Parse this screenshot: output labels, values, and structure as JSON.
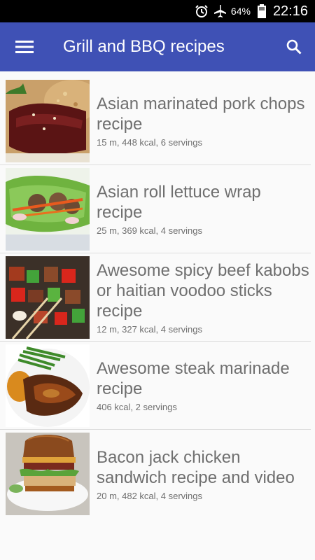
{
  "status": {
    "battery": "64%",
    "time": "22:16",
    "icons": [
      "alarm-icon",
      "airplane-mode-icon",
      "battery-icon"
    ]
  },
  "appbar": {
    "title": "Grill and BBQ recipes",
    "menu_icon": "hamburger-menu-icon",
    "search_icon": "search-icon"
  },
  "colors": {
    "appbar": "#3f51b5",
    "text": "#6f6f6f",
    "background": "#fafafa",
    "divider": "#dddddd"
  },
  "recipes": [
    {
      "title": "Asian marinated pork chops recipe",
      "meta": "15 m, 448 kcal, 6 servings"
    },
    {
      "title": "Asian roll lettuce wrap recipe",
      "meta": "25 m, 369 kcal, 4 servings"
    },
    {
      "title": "Awesome spicy beef kabobs or haitian voodoo sticks recipe",
      "meta": "12 m, 327 kcal, 4 servings"
    },
    {
      "title": "Awesome steak marinade recipe",
      "meta": "406 kcal, 2 servings"
    },
    {
      "title": "Bacon jack chicken sandwich recipe and video",
      "meta": "20 m, 482 kcal, 4 servings"
    }
  ]
}
